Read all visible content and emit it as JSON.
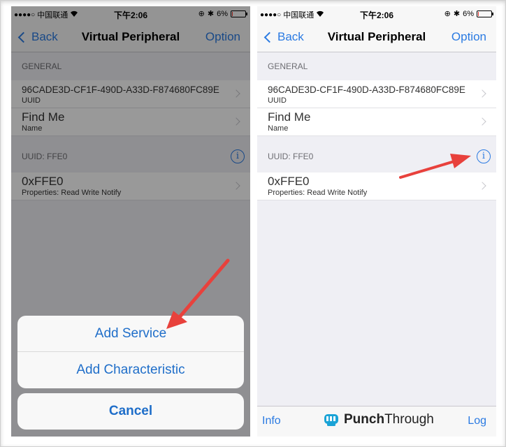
{
  "status_bar": {
    "carrier": "中国联通",
    "signal_dots": "●●●●○",
    "time": "下午2:06",
    "battery": "6%",
    "battery_level_percent": 6
  },
  "nav": {
    "back_label": "Back",
    "title": "Virtual Peripheral",
    "option_label": "Option"
  },
  "general": {
    "header": "GENERAL",
    "uuid_value": "96CADE3D-CF1F-490D-A33D-F874680FC89E",
    "uuid_label": "UUID",
    "name_value": "Find Me",
    "name_label": "Name"
  },
  "service": {
    "header": "UUID: FFE0",
    "info_glyph": "i",
    "characteristic_value": "0xFFE0",
    "characteristic_props": "Properties: Read Write Notify"
  },
  "action_sheet": {
    "options": [
      "Add Service",
      "Add Characteristic"
    ],
    "cancel": "Cancel"
  },
  "toolbar": {
    "info_label": "Info",
    "brand_bold": "Punch",
    "brand_rest": "Through",
    "log_label": "Log"
  },
  "colors": {
    "accent": "#2a7ae2",
    "arrow": "#e8413c",
    "background": "#efeff4"
  },
  "icons": [
    "back-chevron-icon",
    "disclosure-chevron-icon",
    "info-icon",
    "wifi-icon",
    "bluetooth-icon",
    "lock-rotation-icon",
    "battery-icon",
    "punchthrough-logo-icon",
    "red-arrow-annotation"
  ]
}
